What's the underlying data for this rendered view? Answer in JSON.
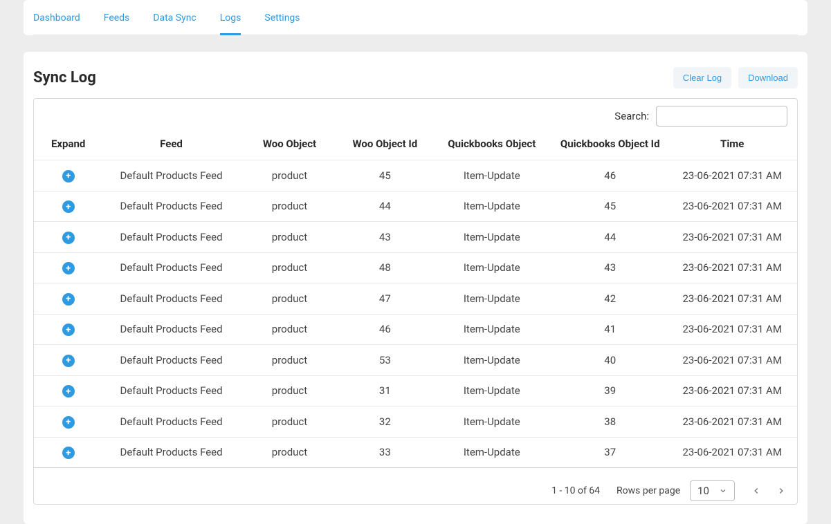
{
  "nav": {
    "tabs": [
      {
        "label": "Dashboard",
        "active": false
      },
      {
        "label": "Feeds",
        "active": false
      },
      {
        "label": "Data Sync",
        "active": false
      },
      {
        "label": "Logs",
        "active": true
      },
      {
        "label": "Settings",
        "active": false
      }
    ]
  },
  "page": {
    "title": "Sync Log"
  },
  "actions": {
    "clear_log": "Clear Log",
    "download": "Download"
  },
  "search": {
    "label": "Search:",
    "value": ""
  },
  "table": {
    "columns": {
      "expand": "Expand",
      "feed": "Feed",
      "woo_object": "Woo Object",
      "woo_object_id": "Woo Object Id",
      "qb_object": "Quickbooks Object",
      "qb_object_id": "Quickbooks Object Id",
      "time": "Time"
    },
    "rows": [
      {
        "feed": "Default Products Feed",
        "woo_object": "product",
        "woo_id": "45",
        "qb_object": "Item-Update",
        "qb_id": "46",
        "time": "23-06-2021 07:31 AM"
      },
      {
        "feed": "Default Products Feed",
        "woo_object": "product",
        "woo_id": "44",
        "qb_object": "Item-Update",
        "qb_id": "45",
        "time": "23-06-2021 07:31 AM"
      },
      {
        "feed": "Default Products Feed",
        "woo_object": "product",
        "woo_id": "43",
        "qb_object": "Item-Update",
        "qb_id": "44",
        "time": "23-06-2021 07:31 AM"
      },
      {
        "feed": "Default Products Feed",
        "woo_object": "product",
        "woo_id": "48",
        "qb_object": "Item-Update",
        "qb_id": "43",
        "time": "23-06-2021 07:31 AM"
      },
      {
        "feed": "Default Products Feed",
        "woo_object": "product",
        "woo_id": "47",
        "qb_object": "Item-Update",
        "qb_id": "42",
        "time": "23-06-2021 07:31 AM"
      },
      {
        "feed": "Default Products Feed",
        "woo_object": "product",
        "woo_id": "46",
        "qb_object": "Item-Update",
        "qb_id": "41",
        "time": "23-06-2021 07:31 AM"
      },
      {
        "feed": "Default Products Feed",
        "woo_object": "product",
        "woo_id": "53",
        "qb_object": "Item-Update",
        "qb_id": "40",
        "time": "23-06-2021 07:31 AM"
      },
      {
        "feed": "Default Products Feed",
        "woo_object": "product",
        "woo_id": "31",
        "qb_object": "Item-Update",
        "qb_id": "39",
        "time": "23-06-2021 07:31 AM"
      },
      {
        "feed": "Default Products Feed",
        "woo_object": "product",
        "woo_id": "32",
        "qb_object": "Item-Update",
        "qb_id": "38",
        "time": "23-06-2021 07:31 AM"
      },
      {
        "feed": "Default Products Feed",
        "woo_object": "product",
        "woo_id": "33",
        "qb_object": "Item-Update",
        "qb_id": "37",
        "time": "23-06-2021 07:31 AM"
      }
    ]
  },
  "pagination": {
    "range": "1 - 10 of 64",
    "rows_label": "Rows per page",
    "rows_value": "10"
  }
}
